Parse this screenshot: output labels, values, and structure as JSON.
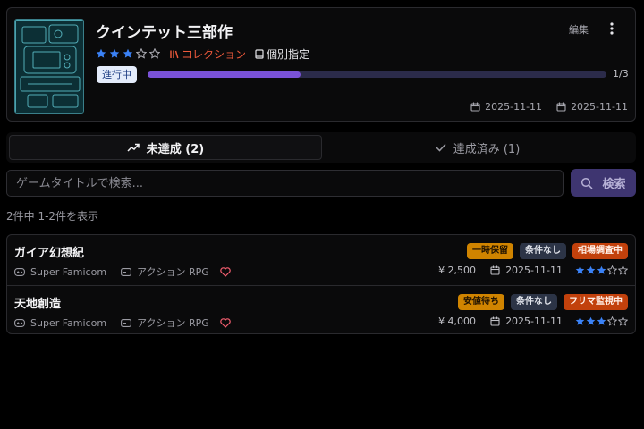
{
  "header": {
    "title": "クインテット三部作",
    "edit_label": "編集",
    "rating": 3,
    "rating_max": 5,
    "collection_label": "コレクション",
    "individual_label": "個別指定",
    "status_label": "進行中",
    "progress_text": "1/3",
    "progress_fraction": 0.333,
    "date_start": "2025-11-11",
    "date_end": "2025-11-11",
    "cover_icon": "retro-console-collage-image"
  },
  "tabs": [
    {
      "label": "未達成 (2)",
      "icon": "trend-up-icon",
      "active": true
    },
    {
      "label": "達成済み (1)",
      "icon": "check-icon",
      "active": false
    }
  ],
  "search": {
    "placeholder": "ゲームタイトルで検索...",
    "value": "",
    "button_label": "検索"
  },
  "result_count": "2件中 1-2件を表示",
  "games": [
    {
      "title": "ガイア幻想紀",
      "badges": [
        {
          "label": "一時保留",
          "color": "orange"
        },
        {
          "label": "条件なし",
          "color": "gray"
        },
        {
          "label": "相場調査中",
          "color": "red"
        }
      ],
      "platform": "Super Famicom",
      "genre": "アクション RPG",
      "price": "¥ 2,500",
      "date": "2025-11-11",
      "rating": 3
    },
    {
      "title": "天地創造",
      "badges": [
        {
          "label": "安値待ち",
          "color": "orange"
        },
        {
          "label": "条件なし",
          "color": "gray"
        },
        {
          "label": "フリマ監視中",
          "color": "red"
        }
      ],
      "platform": "Super Famicom",
      "genre": "アクション RPG",
      "price": "¥ 4,000",
      "date": "2025-11-11",
      "rating": 3
    }
  ],
  "colors": {
    "accent": "#7a52d8",
    "star_filled": "#3b82f6",
    "collection": "#ef5a3c",
    "badge_orange": "#d08400",
    "badge_gray": "#2c3446",
    "badge_red": "#c2410c"
  }
}
